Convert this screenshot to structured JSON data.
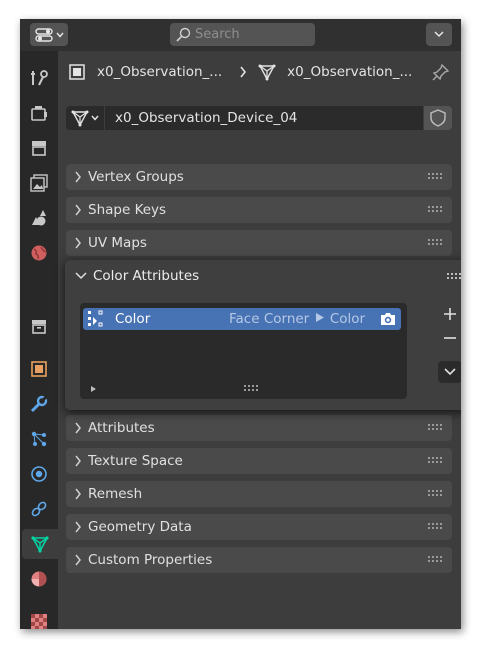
{
  "header": {
    "editor_type_icon": "properties-editor-icon",
    "search": {
      "placeholder": "Search"
    },
    "options_icon": "chevron-down-icon"
  },
  "sidebar": {
    "tabs": [
      {
        "name": "tool",
        "icon": "tool-icon"
      },
      {
        "name": "render",
        "icon": "render-icon"
      },
      {
        "name": "output",
        "icon": "output-icon"
      },
      {
        "name": "view-layer",
        "icon": "view-layer-icon"
      },
      {
        "name": "scene",
        "icon": "scene-icon"
      },
      {
        "name": "world",
        "icon": "world-icon"
      },
      {
        "name": "collection",
        "icon": "collection-icon"
      },
      {
        "name": "object",
        "icon": "object-icon"
      },
      {
        "name": "modifiers",
        "icon": "wrench-icon"
      },
      {
        "name": "particles",
        "icon": "particles-icon"
      },
      {
        "name": "physics",
        "icon": "physics-icon"
      },
      {
        "name": "constraints",
        "icon": "constraints-icon"
      },
      {
        "name": "data",
        "icon": "mesh-data-icon",
        "active": true
      },
      {
        "name": "material",
        "icon": "material-icon"
      },
      {
        "name": "texture",
        "icon": "texture-icon"
      }
    ]
  },
  "breadcrumb": {
    "object_name": "x0_Observation_...",
    "mesh_name": "x0_Observation_..."
  },
  "datablock": {
    "name": "x0_Observation_Device_04"
  },
  "panels_above": [
    {
      "label": "Vertex Groups"
    },
    {
      "label": "Shape Keys"
    },
    {
      "label": "UV Maps"
    }
  ],
  "color_attributes": {
    "title": "Color Attributes",
    "items": [
      {
        "name": "Color",
        "domain": "Face Corner",
        "type": "Color",
        "selected": true
      }
    ]
  },
  "panels_below": [
    {
      "label": "Attributes"
    },
    {
      "label": "Texture Space"
    },
    {
      "label": "Remesh"
    },
    {
      "label": "Geometry Data"
    },
    {
      "label": "Custom Properties"
    }
  ],
  "colors": {
    "accent": "#4772b3",
    "active_tab_icon": "#00d4a3"
  }
}
